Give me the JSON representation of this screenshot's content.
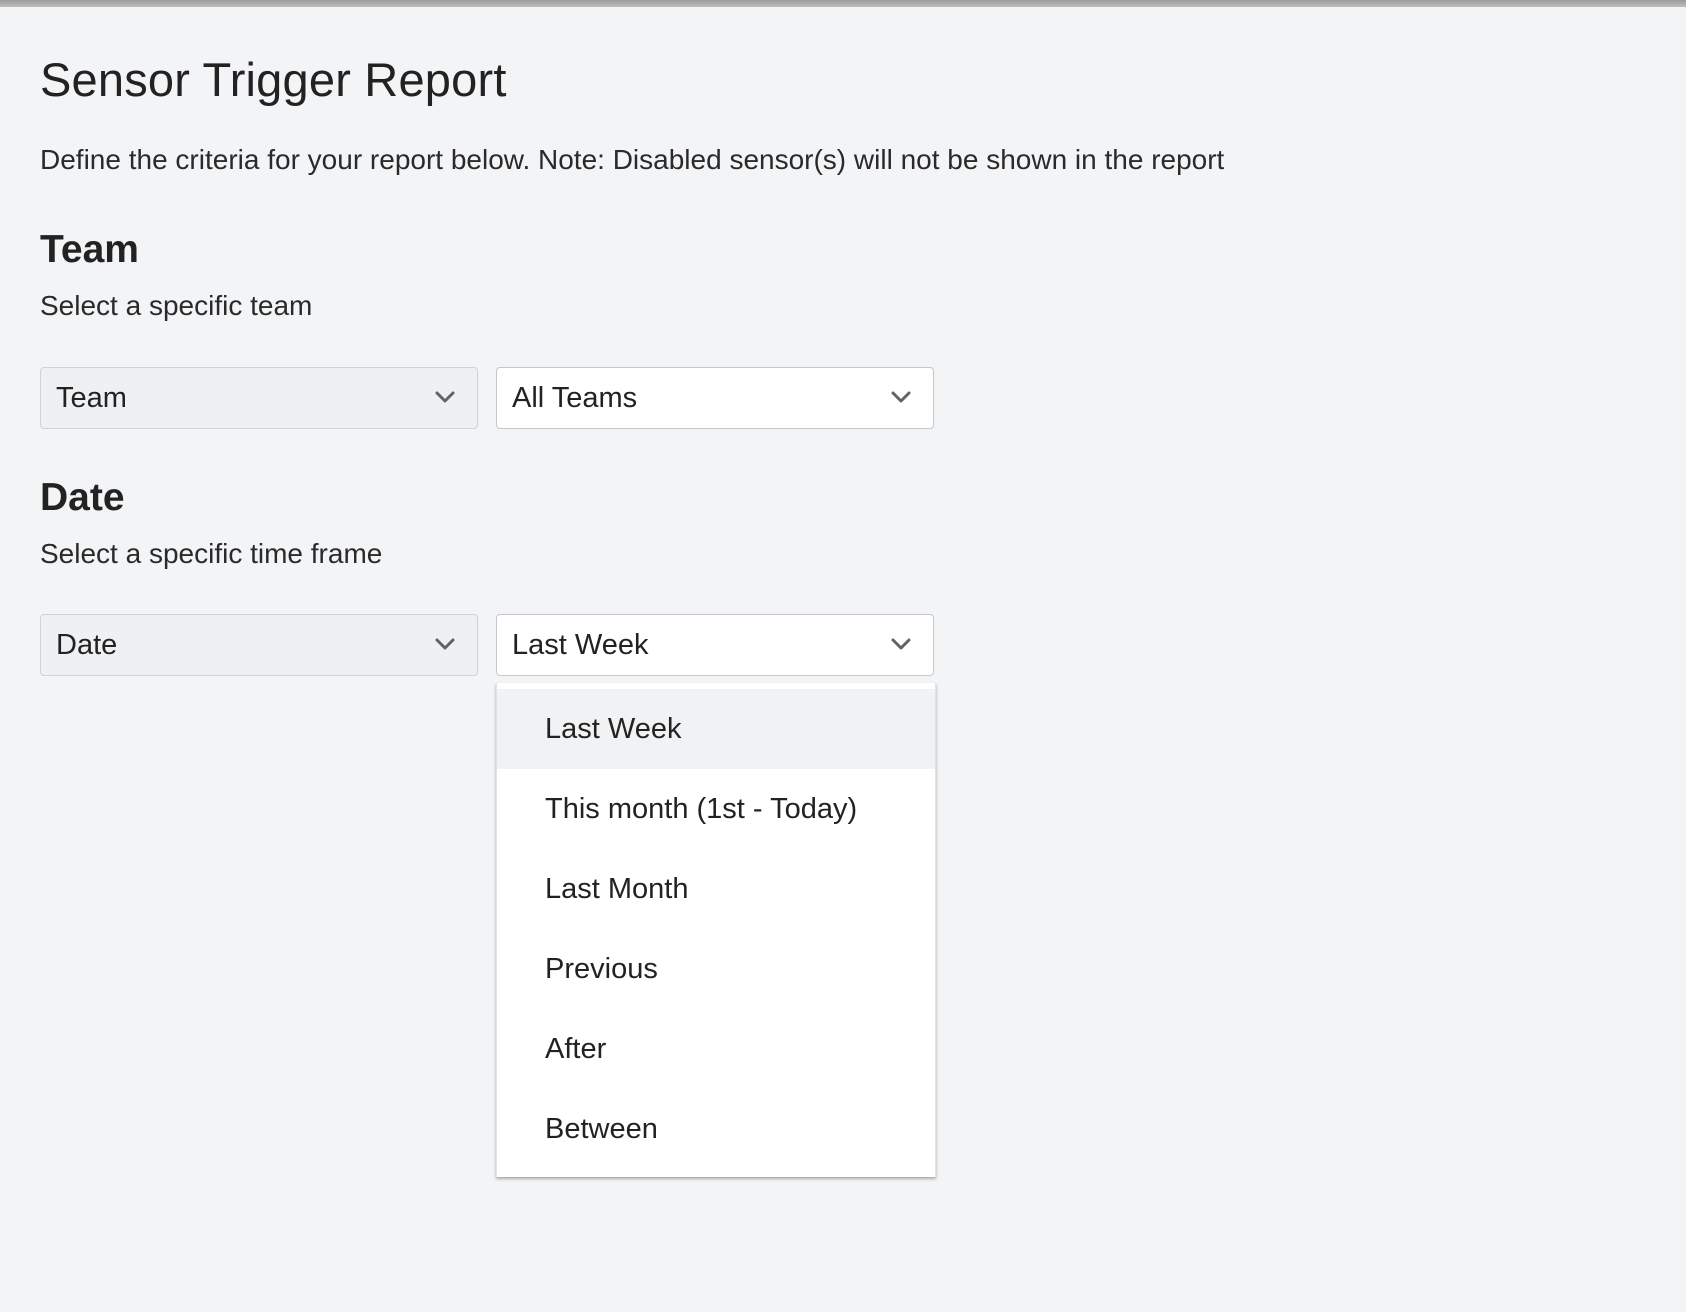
{
  "page": {
    "title": "Sensor Trigger Report",
    "description": "Define the criteria for your report below. Note: Disabled sensor(s) will not be shown in the report"
  },
  "team_section": {
    "title": "Team",
    "description": "Select a specific team",
    "filter_type": "Team",
    "filter_value": "All Teams"
  },
  "date_section": {
    "title": "Date",
    "description": "Select a specific time frame",
    "filter_type": "Date",
    "filter_value": "Last Week",
    "dropdown_open": true,
    "options": [
      "Last Week",
      "This month (1st - Today)",
      "Last Month",
      "Previous",
      "After",
      "Between"
    ],
    "selected_option": "Last Week"
  },
  "icons": {
    "dropdown": "chevron-down-icon"
  },
  "colors": {
    "background": "#f3f4f6",
    "select_type_bg": "#eef0f2",
    "select_value_bg": "#ffffff",
    "menu_hover": "#f1f2f3",
    "text": "#222222"
  }
}
